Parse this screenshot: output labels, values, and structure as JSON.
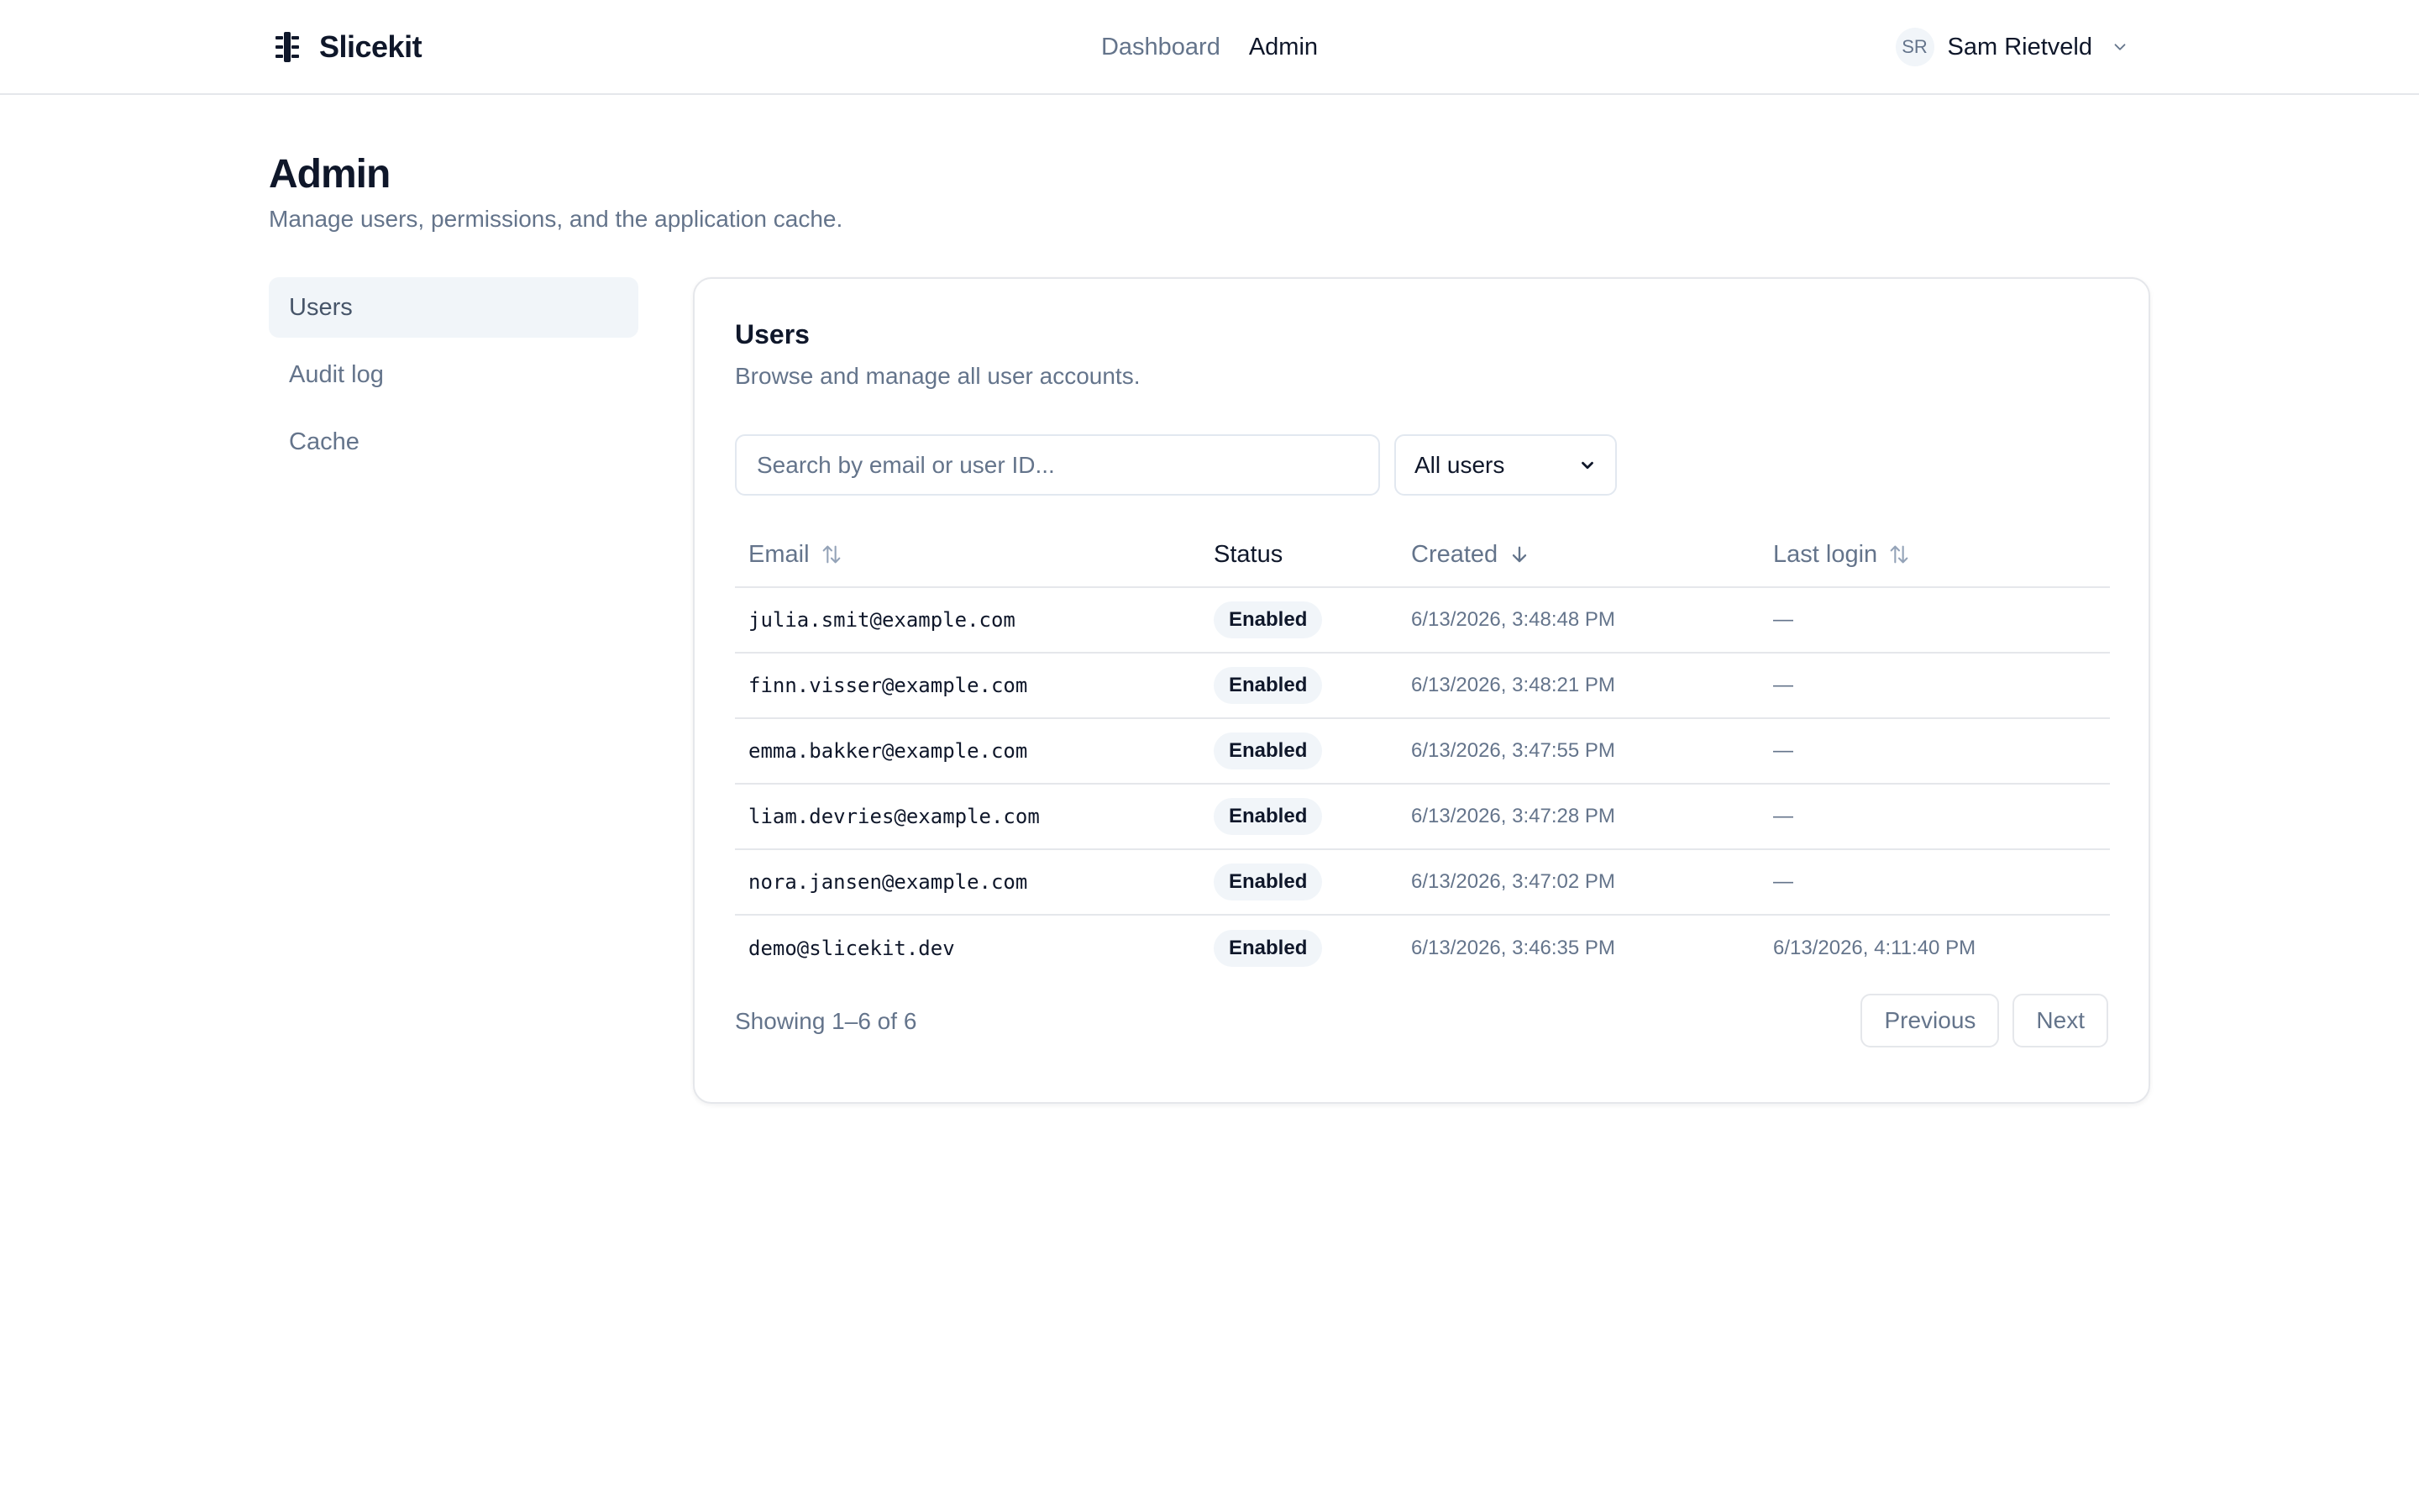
{
  "header": {
    "brand": "Slicekit",
    "nav": [
      {
        "label": "Dashboard",
        "active": false
      },
      {
        "label": "Admin",
        "active": true
      }
    ],
    "user": {
      "initials": "SR",
      "name": "Sam Rietveld"
    }
  },
  "page": {
    "title": "Admin",
    "subtitle": "Manage users, permissions, and the application cache."
  },
  "sidenav": {
    "items": [
      {
        "label": "Users",
        "active": true
      },
      {
        "label": "Audit log",
        "active": false
      },
      {
        "label": "Cache",
        "active": false
      }
    ]
  },
  "users_card": {
    "title": "Users",
    "subtitle": "Browse and manage all user accounts.",
    "search": {
      "placeholder": "Search by email or user ID...",
      "value": ""
    },
    "filter": {
      "selected": "All users"
    },
    "columns": {
      "email": "Email",
      "status": "Status",
      "created": "Created",
      "last_login": "Last login"
    },
    "rows": [
      {
        "email": "julia.smit@example.com",
        "status": "Enabled",
        "created": "6/13/2026, 3:48:48 PM",
        "last_login": "—"
      },
      {
        "email": "finn.visser@example.com",
        "status": "Enabled",
        "created": "6/13/2026, 3:48:21 PM",
        "last_login": "—"
      },
      {
        "email": "emma.bakker@example.com",
        "status": "Enabled",
        "created": "6/13/2026, 3:47:55 PM",
        "last_login": "—"
      },
      {
        "email": "liam.devries@example.com",
        "status": "Enabled",
        "created": "6/13/2026, 3:47:28 PM",
        "last_login": "—"
      },
      {
        "email": "nora.jansen@example.com",
        "status": "Enabled",
        "created": "6/13/2026, 3:47:02 PM",
        "last_login": "—"
      },
      {
        "email": "demo@slicekit.dev",
        "status": "Enabled",
        "created": "6/13/2026, 3:46:35 PM",
        "last_login": "6/13/2026, 4:11:40 PM"
      }
    ],
    "showing": "Showing 1–6 of 6",
    "pager": {
      "previous": "Previous",
      "next": "Next"
    }
  },
  "icons": {
    "logo": "slicekit-logo-icon",
    "user_menu": "chevron-down-icon",
    "filter": "chevron-down-icon",
    "sort_neutral": "sort-arrows-icon",
    "sort_desc": "arrow-down-icon"
  },
  "colors": {
    "text": "#0f172a",
    "muted": "#64748b",
    "border": "#e5e7eb",
    "subtle_bg": "#f1f5f9"
  }
}
